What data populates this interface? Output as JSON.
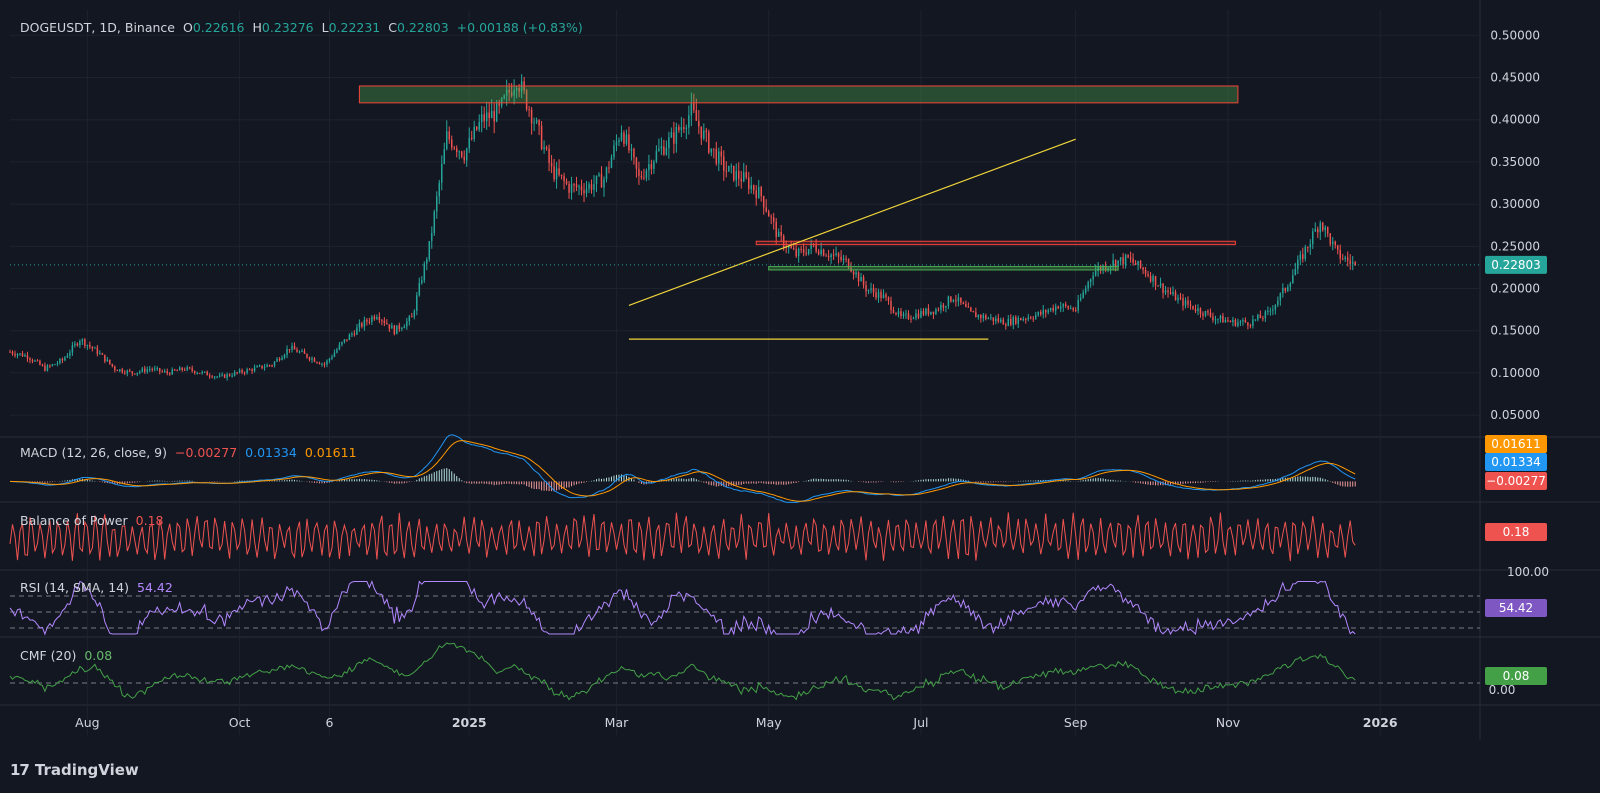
{
  "header": {
    "symbol": "DOGEUSDT, 1D, Binance",
    "open_label": "O",
    "open": "0.22616",
    "high_label": "H",
    "high": "0.23276",
    "low_label": "L",
    "low": "0.22231",
    "close_label": "C",
    "close": "0.22803",
    "change": "+0.00188 (+0.83%)"
  },
  "colors": {
    "background": "#131722",
    "up": "#26a69a",
    "down": "#ef5350",
    "macd_line": "#2962ff",
    "signal_line": "#ff6d00",
    "bop": "#ef5350",
    "rsi": "#7e57c2",
    "cmf": "#43a047",
    "trendline": "#f0d43a",
    "resistance_zone": "#f44336",
    "support_zone": "#4caf50"
  },
  "indicators": {
    "macd": {
      "label": "MACD (12, 26, close, 9)",
      "hist": "−0.00277",
      "macd": "0.01334",
      "signal": "0.01611",
      "badge_signal": "0.01611",
      "badge_macd": "0.01334",
      "badge_hist": "−0.00277"
    },
    "bop": {
      "label": "Balance of Power",
      "value": "0.18",
      "badge": "0.18"
    },
    "rsi": {
      "label": "RSI (14, SMA, 14)",
      "value": "54.42",
      "badge": "54.42",
      "scale_top": "100.00"
    },
    "cmf": {
      "label": "CMF (20)",
      "value": "0.08",
      "badge": "0.08",
      "scale_zero": "0.00"
    }
  },
  "price_badge": "0.22803",
  "footer": {
    "brand": "TradingView",
    "logo": "17"
  },
  "chart_data": {
    "type": "candlestick",
    "title": "DOGEUSDT, 1D, Binance",
    "ylim": [
      0.03,
      0.53
    ],
    "y_ticks": [
      "0.50000",
      "0.45000",
      "0.40000",
      "0.35000",
      "0.30000",
      "0.25000",
      "0.20000",
      "0.15000",
      "0.10000",
      "0.05000"
    ],
    "x_ticks": [
      "Aug",
      "Oct",
      "6",
      "2025",
      "Mar",
      "May",
      "Jul",
      "Sep",
      "Nov",
      "2026"
    ],
    "last_price": 0.22803,
    "price_path": [
      [
        "2024-07-01",
        0.125
      ],
      [
        "2024-07-08",
        0.12
      ],
      [
        "2024-07-15",
        0.105
      ],
      [
        "2024-07-22",
        0.115
      ],
      [
        "2024-07-29",
        0.14
      ],
      [
        "2024-08-05",
        0.125
      ],
      [
        "2024-08-12",
        0.105
      ],
      [
        "2024-08-19",
        0.1
      ],
      [
        "2024-08-26",
        0.105
      ],
      [
        "2024-09-02",
        0.1
      ],
      [
        "2024-09-09",
        0.105
      ],
      [
        "2024-09-16",
        0.1
      ],
      [
        "2024-09-23",
        0.095
      ],
      [
        "2024-09-30",
        0.1
      ],
      [
        "2024-10-07",
        0.105
      ],
      [
        "2024-10-14",
        0.11
      ],
      [
        "2024-10-21",
        0.13
      ],
      [
        "2024-10-28",
        0.12
      ],
      [
        "2024-11-04",
        0.11
      ],
      [
        "2024-11-11",
        0.135
      ],
      [
        "2024-11-18",
        0.155
      ],
      [
        "2024-11-25",
        0.17
      ],
      [
        "2024-12-02",
        0.15
      ],
      [
        "2024-12-09",
        0.165
      ],
      [
        "2024-12-16",
        0.25
      ],
      [
        "2024-12-23",
        0.38
      ],
      [
        "2024-12-30",
        0.36
      ],
      [
        "2025-01-06",
        0.4
      ],
      [
        "2025-01-13",
        0.41
      ],
      [
        "2025-01-20",
        0.45
      ],
      [
        "2025-01-27",
        0.4
      ],
      [
        "2025-02-03",
        0.34
      ],
      [
        "2025-02-10",
        0.32
      ],
      [
        "2025-02-17",
        0.32
      ],
      [
        "2025-02-24",
        0.33
      ],
      [
        "2025-03-03",
        0.39
      ],
      [
        "2025-03-10",
        0.33
      ],
      [
        "2025-03-17",
        0.36
      ],
      [
        "2025-03-24",
        0.38
      ],
      [
        "2025-03-31",
        0.41
      ],
      [
        "2025-04-07",
        0.37
      ],
      [
        "2025-04-14",
        0.34
      ],
      [
        "2025-04-21",
        0.33
      ],
      [
        "2025-04-28",
        0.31
      ],
      [
        "2025-05-05",
        0.26
      ],
      [
        "2025-05-12",
        0.24
      ],
      [
        "2025-05-19",
        0.25
      ],
      [
        "2025-05-26",
        0.24
      ],
      [
        "2025-06-02",
        0.23
      ],
      [
        "2025-06-09",
        0.2
      ],
      [
        "2025-06-16",
        0.19
      ],
      [
        "2025-06-23",
        0.165
      ],
      [
        "2025-06-30",
        0.17
      ],
      [
        "2025-07-07",
        0.175
      ],
      [
        "2025-07-14",
        0.19
      ],
      [
        "2025-07-21",
        0.17
      ],
      [
        "2025-07-28",
        0.165
      ],
      [
        "2025-08-04",
        0.16
      ],
      [
        "2025-08-11",
        0.165
      ],
      [
        "2025-08-18",
        0.17
      ],
      [
        "2025-08-25",
        0.18
      ],
      [
        "2025-09-01",
        0.175
      ],
      [
        "2025-09-08",
        0.22
      ],
      [
        "2025-09-15",
        0.23
      ],
      [
        "2025-09-22",
        0.235
      ],
      [
        "2025-09-29",
        0.22
      ],
      [
        "2025-10-06",
        0.2
      ],
      [
        "2025-10-13",
        0.185
      ],
      [
        "2025-10-20",
        0.175
      ],
      [
        "2025-10-27",
        0.165
      ],
      [
        "2025-11-03",
        0.16
      ],
      [
        "2025-11-10",
        0.16
      ],
      [
        "2025-11-17",
        0.17
      ],
      [
        "2025-11-24",
        0.2
      ],
      [
        "2025-12-01",
        0.24
      ],
      [
        "2025-12-08",
        0.28
      ],
      [
        "2025-12-15",
        0.24
      ],
      [
        "2025-12-22",
        0.228
      ]
    ],
    "zones": [
      {
        "kind": "resistance",
        "from": 0.42,
        "to": 0.44
      },
      {
        "kind": "resistance",
        "from": 0.252,
        "to": 0.256
      },
      {
        "kind": "support",
        "from": 0.222,
        "to": 0.226
      }
    ],
    "trendlines": [
      {
        "from": [
          0.18,
          0.18
        ],
        "to": [
          0.38,
          0.377
        ]
      },
      {
        "from": [
          0.14,
          0.14
        ],
        "to": [
          0.14,
          0.14
        ]
      }
    ],
    "grid": true
  }
}
